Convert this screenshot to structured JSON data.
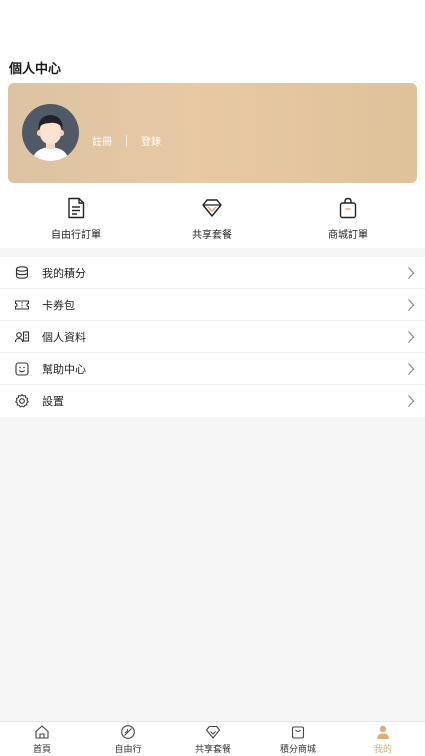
{
  "header": {
    "title": "個人中心"
  },
  "profile": {
    "register_label": "註冊",
    "login_label": "登錄"
  },
  "quick_actions": [
    {
      "label": "自由行訂單",
      "icon": "document-icon"
    },
    {
      "label": "共享套餐",
      "icon": "diamond-icon"
    },
    {
      "label": "商城訂單",
      "icon": "shopping-bag-icon"
    }
  ],
  "menu": [
    {
      "label": "我的積分",
      "icon": "coins-stack-icon"
    },
    {
      "label": "卡券包",
      "icon": "ticket-icon"
    },
    {
      "label": "個人資料",
      "icon": "id-card-icon"
    },
    {
      "label": "幫助中心",
      "icon": "help-face-icon"
    },
    {
      "label": "設置",
      "icon": "gear-icon"
    }
  ],
  "tabbar": {
    "active_index": 4,
    "active_color": "#d9b07a",
    "items": [
      {
        "label": "首頁",
        "icon": "home-icon"
      },
      {
        "label": "自由行",
        "icon": "compass-icon"
      },
      {
        "label": "共享套餐",
        "icon": "diamond-icon"
      },
      {
        "label": "積分商城",
        "icon": "shopping-bag-icon"
      },
      {
        "label": "我的",
        "icon": "person-icon"
      }
    ]
  }
}
